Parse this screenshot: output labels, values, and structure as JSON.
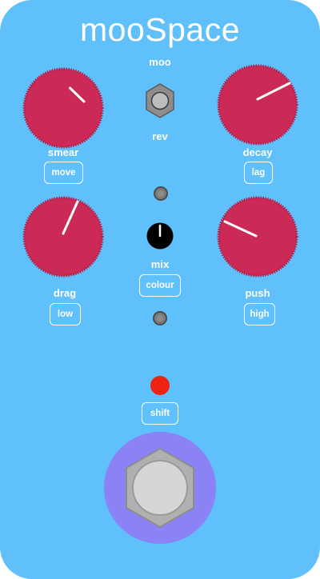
{
  "app": {
    "title": "mooSpace"
  },
  "toggle": {
    "top_label": "moo",
    "bottom_label": "rev"
  },
  "knobs": {
    "smear": {
      "label": "smear",
      "button": "move"
    },
    "decay": {
      "label": "decay",
      "button": "lag"
    },
    "drag": {
      "label": "drag",
      "button": "low"
    },
    "push": {
      "label": "push",
      "button": "high"
    },
    "mix": {
      "label": "mix",
      "button": "colour"
    }
  },
  "shift": {
    "button": "shift"
  },
  "colors": {
    "body": "#5fc0fb",
    "knob": "#cb2a57",
    "led": "#ee2211",
    "footswitch_ring": "#8a82f5"
  },
  "icons": {
    "toggle_switch": "hexagon-toggle-icon",
    "footswitch": "hexagon-footswitch-icon",
    "led": "led-icon"
  }
}
